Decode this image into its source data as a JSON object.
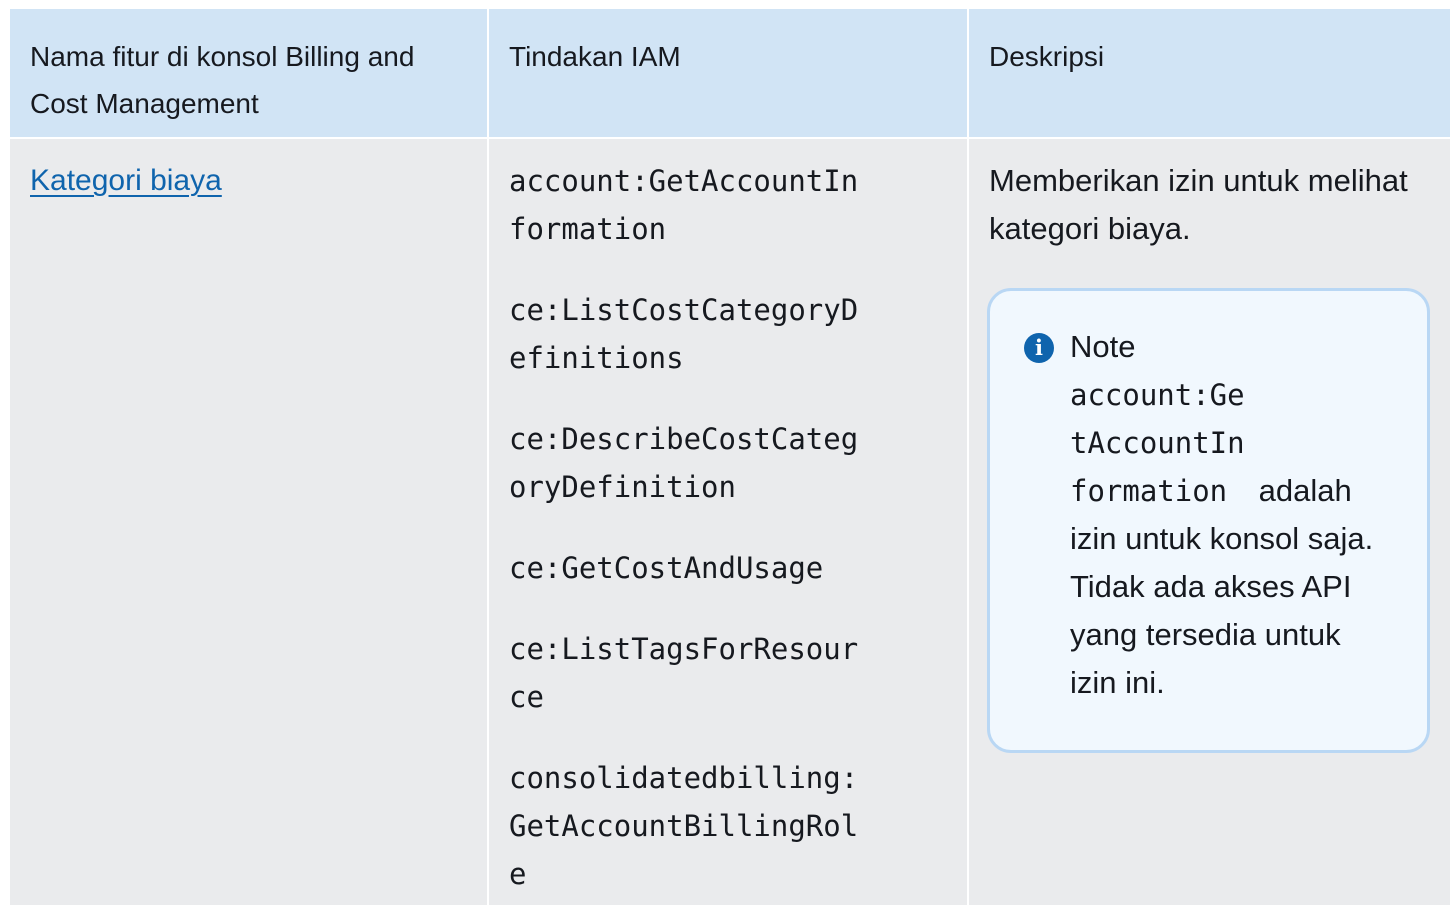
{
  "table": {
    "headers": [
      "Nama fitur di konsol Billing and Cost Management",
      "Tindakan IAM",
      "Deskripsi"
    ],
    "row": {
      "feature_link": "Kategori biaya",
      "actions": [
        "account:GetAccountInformation",
        "ce:ListCostCategoryDefinitions",
        "ce:DescribeCostCategoryDefinition",
        "ce:GetCostAndUsage",
        "ce:ListTagsForResource",
        "consolidatedbilling:GetAccountBillingRole"
      ],
      "description": "Memberikan izin untuk melihat kategori biaya.",
      "note": {
        "icon": "info-icon",
        "title": "Note",
        "code": "account:GetAccountInformation",
        "text": " adalah izin untuk konsol saja. Tidak ada akses API yang tersedia untuk izin ini."
      }
    }
  },
  "colors": {
    "header_bg": "#d1e4f5",
    "body_bg": "#eaebed",
    "link": "#0f64ad",
    "note_bg": "#f1f8fe",
    "note_border": "#b9d7f4"
  }
}
